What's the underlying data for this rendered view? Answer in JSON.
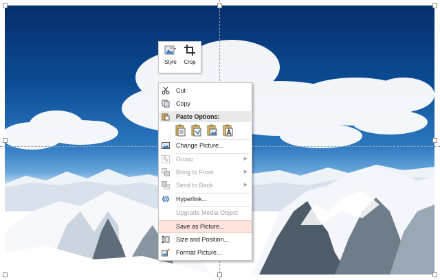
{
  "mini_toolbar": {
    "style_label": "Style",
    "crop_label": "Crop"
  },
  "context_menu": {
    "items": [
      {
        "label": "Cut",
        "icon": "scissors-icon",
        "enabled": true
      },
      {
        "label": "Copy",
        "icon": "copy-icon",
        "enabled": true
      },
      {
        "label": "Paste Options:",
        "icon": "clipboard-icon",
        "enabled": true,
        "header": true
      },
      {
        "label": "Change Picture...",
        "icon": "change-picture-icon",
        "enabled": true
      },
      {
        "label": "Group",
        "icon": "group-icon",
        "enabled": false,
        "submenu": true
      },
      {
        "label": "Bring to Front",
        "icon": "bring-to-front-icon",
        "enabled": false,
        "submenu": true
      },
      {
        "label": "Send to Back",
        "icon": "send-to-back-icon",
        "enabled": false,
        "submenu": true
      },
      {
        "label": "Hyperlink...",
        "icon": "hyperlink-icon",
        "enabled": true
      },
      {
        "label": "Upgrade Media Object",
        "icon": "",
        "enabled": false
      },
      {
        "label": "Save as Picture...",
        "icon": "",
        "enabled": true,
        "highlighted": true
      },
      {
        "label": "Size and Position...",
        "icon": "size-position-icon",
        "enabled": true
      },
      {
        "label": "Format Picture...",
        "icon": "format-picture-icon",
        "enabled": true
      }
    ],
    "paste_option_icons": [
      "paste-keep-formatting-icon",
      "paste-merge-formatting-icon",
      "paste-picture-icon",
      "paste-text-only-icon"
    ]
  },
  "colors": {
    "menu_highlight": "#fde4df",
    "sky_dark": "#062f6b",
    "disabled_text": "#a3a3a3"
  }
}
